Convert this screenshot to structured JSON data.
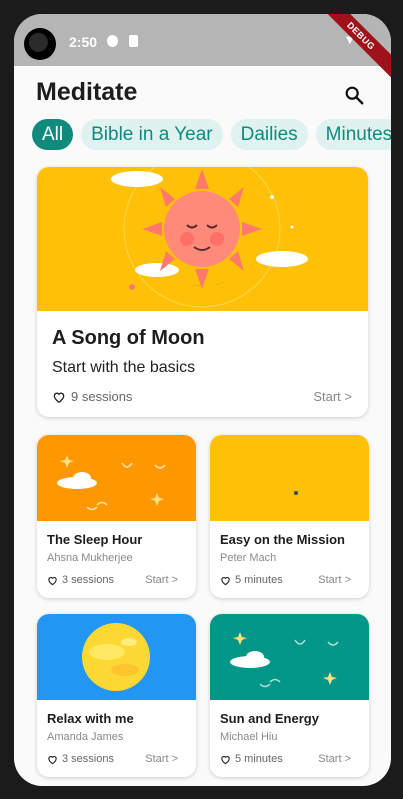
{
  "status_bar": {
    "time": "2:50",
    "debug_banner": "DEBUG"
  },
  "header": {
    "title": "Meditate"
  },
  "chips": [
    "All",
    "Bible in a Year",
    "Dailies",
    "Minutes"
  ],
  "featured": {
    "title": "A Song of Moon",
    "subtitle": "Start with the basics",
    "meta": "9 sessions",
    "action": "Start >"
  },
  "cards": [
    {
      "title": "The Sleep Hour",
      "author": "Ahsna Mukherjee",
      "meta": "3 sessions",
      "action": "Start >"
    },
    {
      "title": "Easy on the Mission",
      "author": "Peter Mach",
      "meta": "5 minutes",
      "action": "Start >"
    },
    {
      "title": "Relax with me",
      "author": "Amanda James",
      "meta": "3 sessions",
      "action": "Start >"
    },
    {
      "title": "Sun and Energy",
      "author": "Michael Hiu",
      "meta": "5 minutes",
      "action": "Start >"
    }
  ],
  "colors": {
    "accent": "#0f8a7d",
    "chip_bg": "#e0f2f0",
    "yellow": "#ffc107",
    "orange": "#ff9800",
    "blue": "#2196f3",
    "teal": "#009688"
  }
}
